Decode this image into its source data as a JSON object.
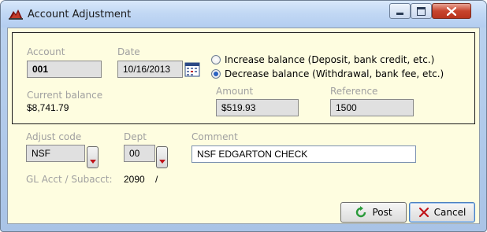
{
  "window": {
    "title": "Account Adjustment"
  },
  "account": {
    "label": "Account",
    "value": "001"
  },
  "date": {
    "label": "Date",
    "value": "10/16/2013"
  },
  "current_balance": {
    "label": "Current balance",
    "value": "$8,741.79"
  },
  "balance_options": [
    {
      "label": "Increase balance (Deposit, bank credit, etc.)",
      "checked": false
    },
    {
      "label": "Decrease balance (Withdrawal, bank fee, etc.)",
      "checked": true
    }
  ],
  "amount": {
    "label": "Amount",
    "value": "$519.93"
  },
  "reference": {
    "label": "Reference",
    "value": "1500"
  },
  "adjust_code": {
    "label": "Adjust code",
    "value": "NSF"
  },
  "dept": {
    "label": "Dept",
    "value": "00"
  },
  "comment": {
    "label": "Comment",
    "value": "NSF EDGARTON CHECK"
  },
  "gl_acct": {
    "label": "GL Acct / Subacct:",
    "acct": "2090",
    "sep": "/"
  },
  "buttons": {
    "post": "Post",
    "cancel": "Cancel"
  },
  "colors": {
    "client_bg": "#fefde0",
    "accent": "#2b62c0",
    "close": "#c7442d"
  }
}
